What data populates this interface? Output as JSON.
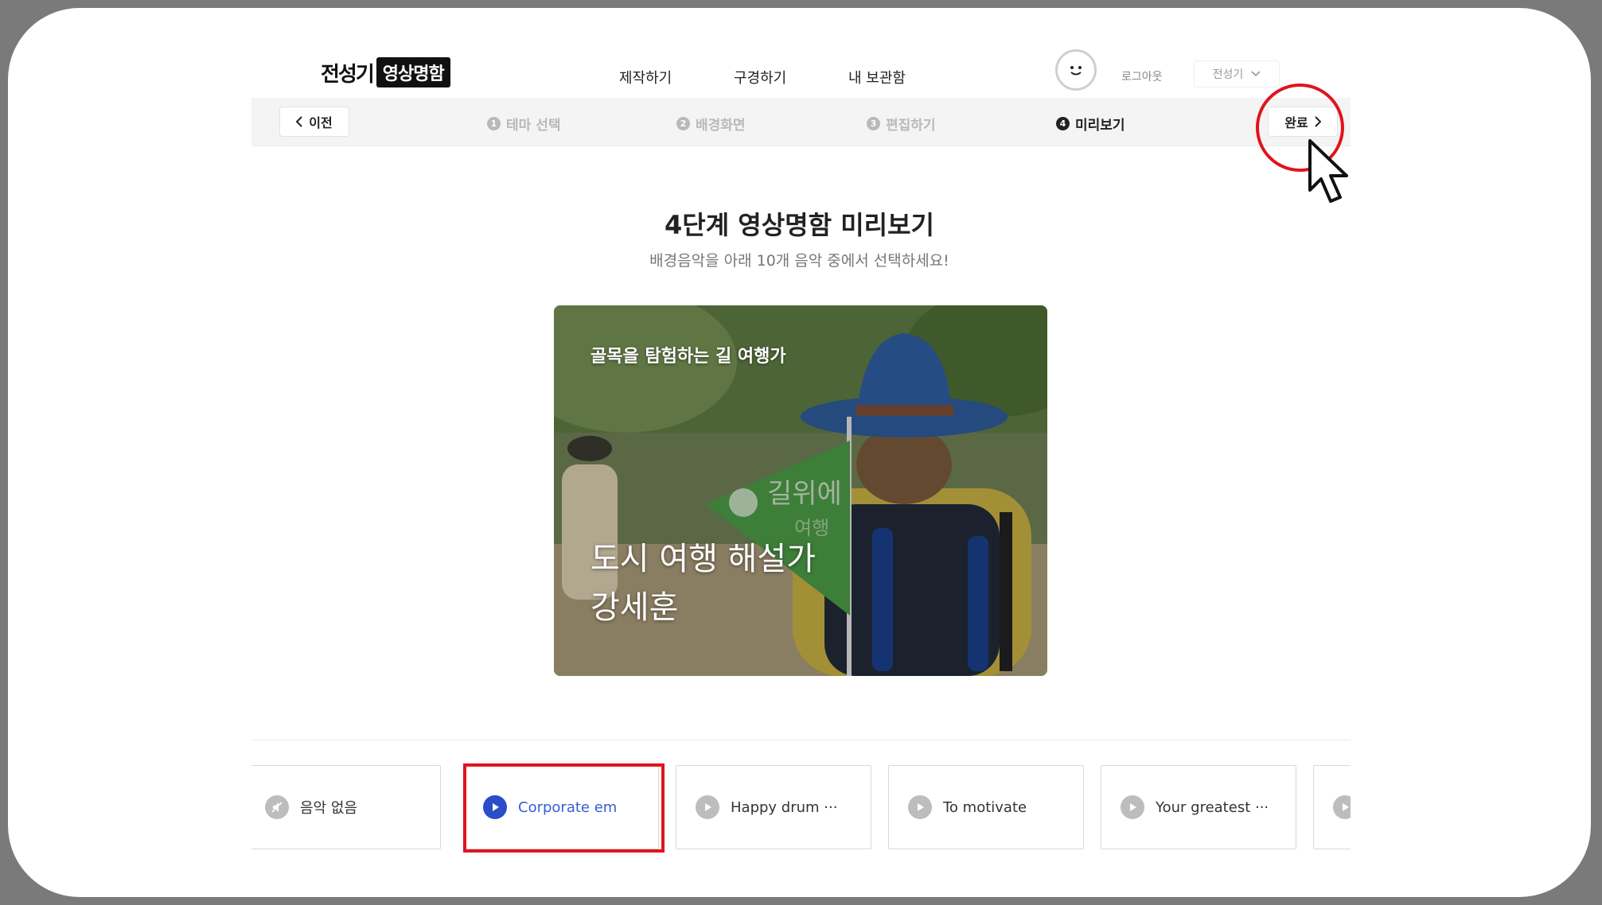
{
  "header": {
    "logo_part1": "전성기",
    "logo_part2": "영상명함",
    "nav": [
      "제작하기",
      "구경하기",
      "내 보관함"
    ],
    "logout": "로그아웃",
    "user_name": "전성기"
  },
  "stepbar": {
    "prev_label": "이전",
    "done_label": "완료",
    "steps": [
      {
        "num": "1",
        "label": "테마 선택"
      },
      {
        "num": "2",
        "label": "배경화면"
      },
      {
        "num": "3",
        "label": "편집하기"
      },
      {
        "num": "4",
        "label": "미리보기"
      }
    ],
    "active_step": 4
  },
  "main": {
    "title": "4단계 영상명함 미리보기",
    "subtitle": "배경음악을 아래 10개 음악 중에서 선택하세요!"
  },
  "preview": {
    "tagline": "골목을 탐험하는 길 여행가",
    "job": "도시 여행 해설가",
    "name": "강세훈",
    "flag_text_1": "길위에",
    "flag_text_2": "여행"
  },
  "music": {
    "items": [
      {
        "label": "음악 없음",
        "icon": "mute-icon"
      },
      {
        "label": "Corporate em",
        "icon": "play-icon"
      },
      {
        "label": "Happy drum ···",
        "icon": "play-icon"
      },
      {
        "label": "To motivate",
        "icon": "play-icon"
      },
      {
        "label": "Your greatest ···",
        "icon": "play-icon"
      }
    ],
    "selected_index": 1
  },
  "colors": {
    "highlight": "#e0141e",
    "selected_blue": "#2a4ec7",
    "stepbar_bg": "#f4f4f4"
  }
}
